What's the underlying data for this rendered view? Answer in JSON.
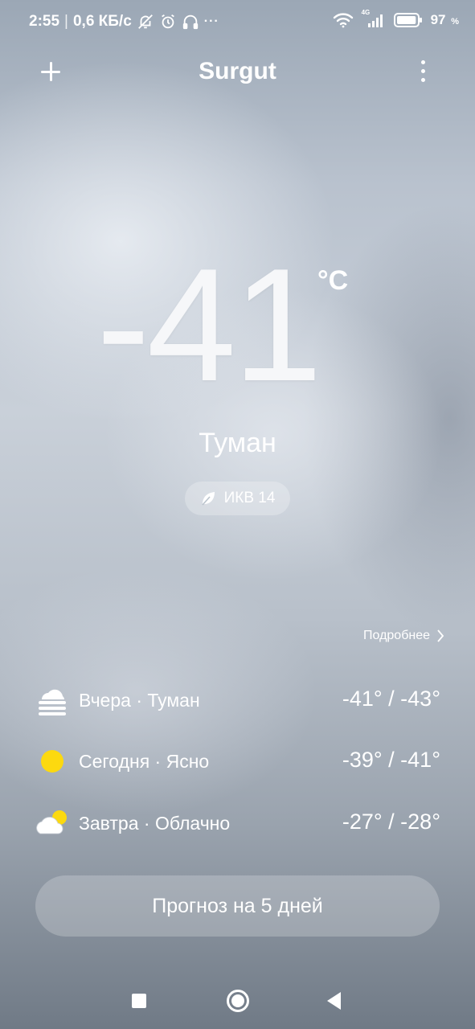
{
  "status_bar": {
    "time": "2:55",
    "separator": "|",
    "network_speed": "0,6 КБ/с",
    "more_indicator": "···",
    "network_type": "4G",
    "battery_percent": "97",
    "battery_unit": "%",
    "battery_level": 97,
    "icons": [
      "notifications-off-icon",
      "alarm-icon",
      "headphones-icon",
      "wifi-icon",
      "cellular-signal-icon",
      "battery-icon"
    ]
  },
  "header": {
    "city": "Surgut",
    "add_icon": "plus-icon",
    "menu_icon": "more-vertical-icon"
  },
  "current": {
    "temperature": "-41",
    "unit": "°C",
    "condition": "Туман",
    "aqi_label": "ИКВ 14",
    "aqi_icon": "leaf-icon"
  },
  "details_link": "Подробнее",
  "forecast": [
    {
      "label": "Вчера · Туман",
      "temps": "-41° / -43°",
      "icon": "fog-icon"
    },
    {
      "label": "Сегодня · Ясно",
      "temps": "-39° / -41°",
      "icon": "sun-icon"
    },
    {
      "label": "Завтра · Облачно",
      "temps": "-27° / -28°",
      "icon": "partly-cloudy-icon"
    }
  ],
  "forecast_button": "Прогноз на 5 дней",
  "colors": {
    "sun": "#fcd90f",
    "text": "#ffffff"
  },
  "nav_bar": {
    "icons": [
      "recents-icon",
      "home-icon",
      "back-icon"
    ]
  }
}
